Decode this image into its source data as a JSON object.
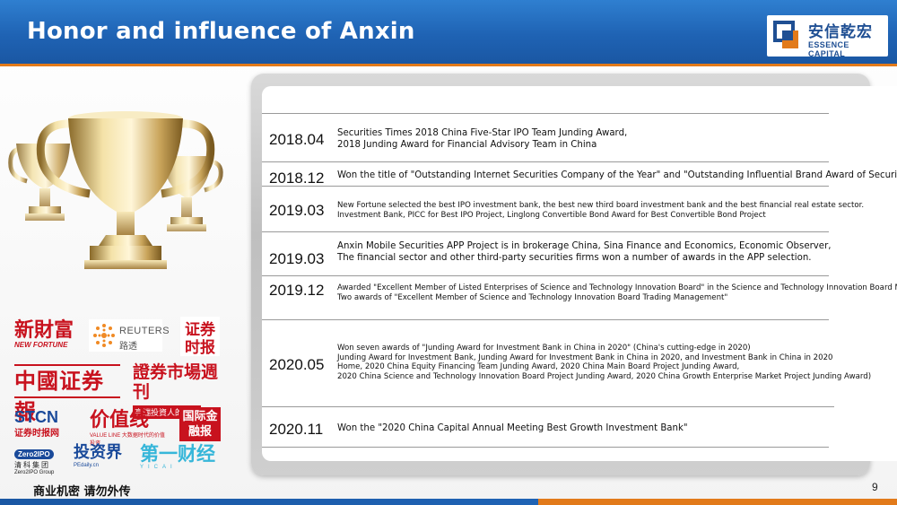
{
  "header": {
    "title": "Honor and influence of Anxin",
    "logo_cn": "安信乾宏",
    "logo_en": "ESSENCE CAPITAL",
    "brand_color": "#1f63b4",
    "accent_color": "#e27a1a"
  },
  "awards": [
    {
      "year": "2018.04",
      "lines": [
        "Securities Times 2018 China Five-Star IPO Team Junding Award,",
        "2018 Junding Award for Financial Advisory Team in China"
      ]
    },
    {
      "year": "2018.12",
      "lines": [
        "Won the title of \"Outstanding Internet Securities Company of the Year\" and \"Outstanding Influential Brand Award of Securities"
      ]
    },
    {
      "year": "2019.03",
      "lines": [
        "New Fortune selected the best IPO investment bank, the best new third board investment bank and the best financial real estate sector.",
        "Investment Bank, PICC for Best IPO Project, Linglong Convertible Bond Award for Best Convertible Bond Project"
      ]
    },
    {
      "year": "2019.03",
      "lines": [
        "Anxin Mobile Securities APP Project is in brokerage China, Sina Finance and Economics, Economic Observer,",
        "The financial sector and other third-party securities firms won a number of awards in the APP selection."
      ]
    },
    {
      "year": "2019.12",
      "lines": [
        "Awarded \"Excellent Member of Listed Enterprises of Science and Technology Innovation Board\" in the Science and Technology Innovation Board Market of Sh",
        "Two awards of \"Excellent Member of Science and Technology Innovation Board Trading Management\""
      ]
    },
    {
      "year": "2020.05",
      "lines": [
        "Won seven awards of \"Junding Award for Investment Bank in China in 2020\" (China's cutting-edge in 2020)",
        "Junding Award for Investment Bank, Junding Award for Investment Bank in China in 2020, and Investment Bank in China in 2020",
        "Home, 2020 China Equity Financing Team Junding Award, 2020 China Main Board Project Junding Award,",
        "2020 China Science and Technology Innovation Board Project Junding Award, 2020 China Growth Enterprise Market Project Junding Award)"
      ]
    },
    {
      "year": "2020.11",
      "lines": [
        "Won the \"2020 China Capital Annual Meeting Best Growth Investment Bank\""
      ]
    }
  ],
  "media": {
    "xcf_cn": "新財富",
    "xcf_en": "NEW FORTUNE",
    "reuters_en": "REUTERS",
    "reuters_cn": "路透",
    "zqsb": "证券时报",
    "zgzqb": "中國证券報",
    "zqsczk_1": "證券市場週刊",
    "zqsczk_2": "高端投資人的利器",
    "stcn_en": "STCN",
    "stcn_cn": "证券时报网",
    "jzx_cn": "价值线",
    "jzx_sub": "VALUE LINE 大数据时代的价值投资",
    "gjjr": "国际金融报",
    "zero2ipo_top": "Zero2IPO",
    "zero2ipo_cn": "清科集团",
    "zero2ipo_en": "Zero2IPO Group",
    "tzj_cn": "投资界",
    "tzj_en": "PEdaily.cn",
    "dycj_cn": "第一财经",
    "dycj_en": "YICAI"
  },
  "footer": {
    "confidential": "商业机密 请勿外传",
    "page": "9"
  }
}
